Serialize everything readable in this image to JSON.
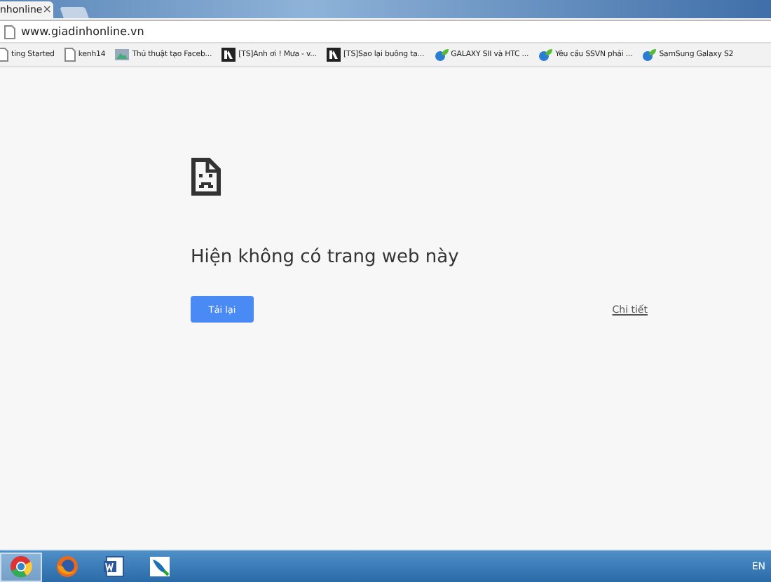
{
  "tab": {
    "title": "nhonline",
    "close": "×"
  },
  "address_bar": {
    "url": "www.giadinhonline.vn"
  },
  "bookmarks": [
    {
      "kind": "page",
      "label": "ting Started"
    },
    {
      "kind": "page",
      "label": "kenh14"
    },
    {
      "kind": "image",
      "label": "Thủ thuật tạo Faceb..."
    },
    {
      "kind": "ts",
      "label": "[TS]Anh ơi ! Mưa - v..."
    },
    {
      "kind": "ts",
      "label": "[TS]Sao lại buông ta..."
    },
    {
      "kind": "globe",
      "label": "GALAXY SII và HTC ..."
    },
    {
      "kind": "globe",
      "label": "Yêu cầu SSVN phải ..."
    },
    {
      "kind": "globe",
      "label": "SamSung Galaxy S2"
    }
  ],
  "error_page": {
    "message": "Hiện không có trang web này",
    "reload_button": "Tải lại",
    "details_link": "Chi tiết"
  },
  "taskbar": {
    "apps": [
      {
        "kind": "chrome",
        "selected": true
      },
      {
        "kind": "firefox",
        "selected": false
      },
      {
        "kind": "word",
        "selected": false
      },
      {
        "kind": "feather",
        "selected": false
      }
    ],
    "language": "EN"
  }
}
